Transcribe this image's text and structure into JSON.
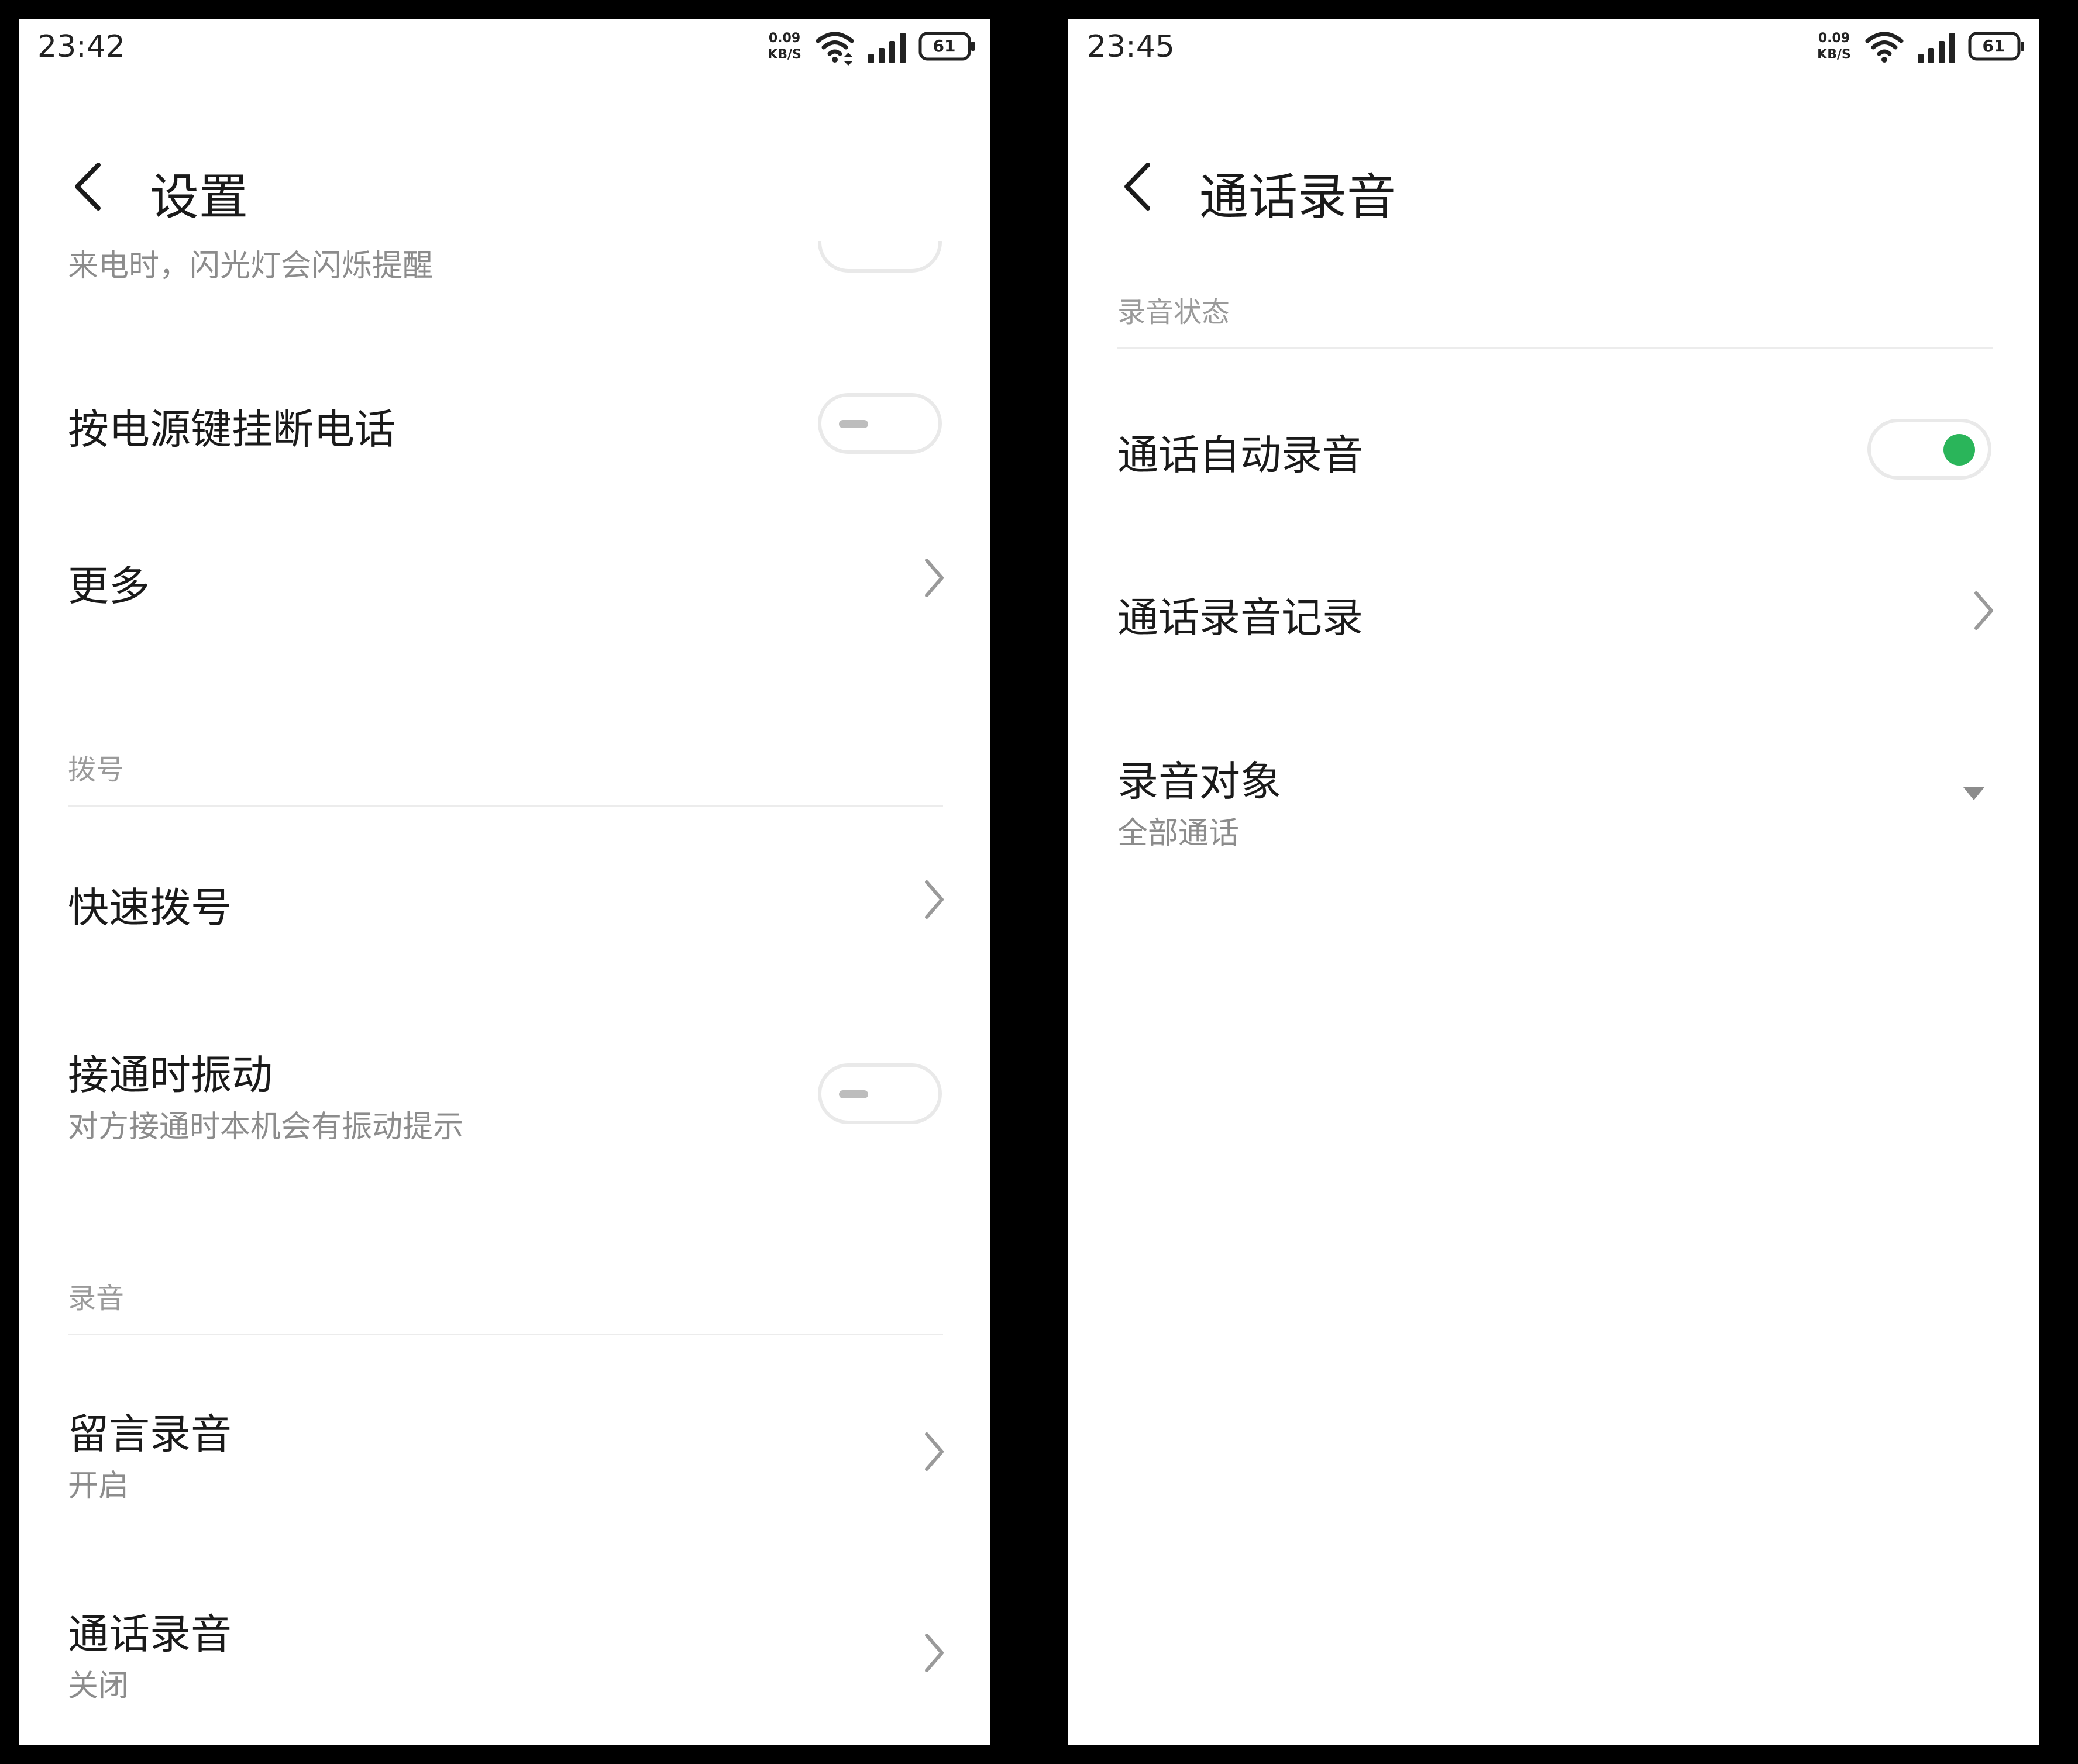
{
  "left_screen": {
    "status_bar": {
      "time": "23:42",
      "speed_value": "0.09",
      "speed_unit": "KB/S",
      "battery": "61"
    },
    "header": {
      "back_icon": "chevron-left-icon",
      "title": "设置"
    },
    "partial_item_text": "来电时，闪光灯会闪烁提醒",
    "items_top": [
      {
        "title": "按电源键挂断电话",
        "control": "toggle",
        "state": "off"
      },
      {
        "title": "更多",
        "control": "chevron"
      }
    ],
    "sections": [
      {
        "header": "拨号",
        "items": [
          {
            "title": "快速拨号",
            "control": "chevron"
          },
          {
            "title": "接通时振动",
            "subtitle": "对方接通时本机会有振动提示",
            "control": "toggle",
            "state": "off"
          }
        ]
      },
      {
        "header": "录音",
        "items": [
          {
            "title": "留言录音",
            "subtitle": "开启",
            "control": "chevron"
          },
          {
            "title": "通话录音",
            "subtitle": "关闭",
            "control": "chevron"
          }
        ]
      }
    ]
  },
  "right_screen": {
    "status_bar": {
      "time": "23:45",
      "speed_value": "0.09",
      "speed_unit": "KB/S",
      "battery": "61"
    },
    "header": {
      "back_icon": "chevron-left-icon",
      "title": "通话录音"
    },
    "section": {
      "header": "录音状态",
      "items": [
        {
          "title": "通话自动录音",
          "control": "toggle",
          "state": "on"
        },
        {
          "title": "通话录音记录",
          "control": "chevron"
        },
        {
          "title": "录音对象",
          "subtitle": "全部通话",
          "control": "dropdown"
        }
      ]
    }
  },
  "colors": {
    "accent_green": "#2ab55a",
    "text_primary": "#1a1a1a",
    "text_secondary": "#8c8c8c",
    "divider": "#ececec"
  }
}
